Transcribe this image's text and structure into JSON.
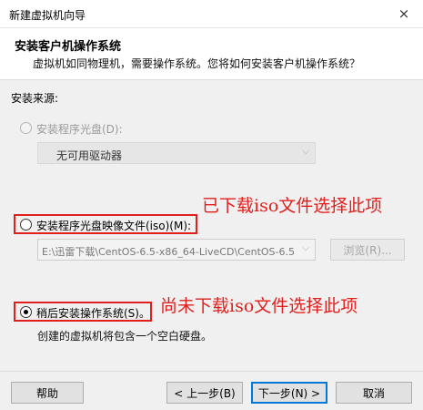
{
  "window": {
    "title": "新建虚拟机向导",
    "close_icon": "×"
  },
  "header": {
    "title": "安装客户机操作系统",
    "subtitle": "虚拟机如同物理机，需要操作系统。您将如何安装客户机操作系统？"
  },
  "source": {
    "label": "安装来源:",
    "options": [
      {
        "label": "安装程序光盘(D):",
        "selected": false,
        "enabled": false
      },
      {
        "label": "安装程序光盘映像文件(iso)(M):",
        "selected": false,
        "enabled": true
      },
      {
        "label": "稍后安装操作系统(S)。",
        "selected": true,
        "enabled": true
      }
    ],
    "disc_dropdown": "无可用驱动器",
    "iso_path": "E:\\迅雷下载\\CentOS-6.5-x86_64-LiveCD\\CentOS-6.5-x",
    "browse_label": "浏览(R)...",
    "later_description": "创建的虚拟机将包含一个空白硬盘。"
  },
  "annotations": {
    "iso_note": "已下载iso文件选择此项",
    "later_note": "尚未下载iso文件选择此项",
    "color": "#e0201e"
  },
  "footer": {
    "help": "帮助",
    "back": "< 上一步(B)",
    "next": "下一步(N) >",
    "cancel": "取消"
  }
}
